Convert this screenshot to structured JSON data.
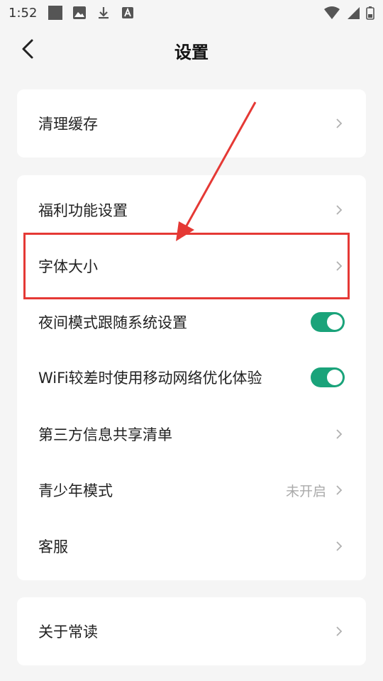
{
  "status_bar": {
    "time": "1:52",
    "left_icons": [
      "notification-square-icon",
      "image-icon",
      "download-icon",
      "font-badge-icon"
    ],
    "right_icons": [
      "wifi-icon",
      "signal-icon",
      "battery-icon"
    ]
  },
  "header": {
    "title": "设置",
    "back_icon": "chevron-left-icon"
  },
  "cards": [
    {
      "rows": [
        {
          "label": "清理缓存",
          "control": "chevron"
        }
      ]
    },
    {
      "rows": [
        {
          "label": "福利功能设置",
          "control": "chevron"
        },
        {
          "label": "字体大小",
          "control": "chevron"
        },
        {
          "label": "夜间模式跟随系统设置",
          "control": "toggle",
          "on": true
        },
        {
          "label": "WiFi较差时使用移动网络优化体验",
          "control": "toggle",
          "on": true
        },
        {
          "label": "第三方信息共享清单",
          "control": "chevron"
        },
        {
          "label": "青少年模式",
          "control": "chevron",
          "value": "未开启"
        },
        {
          "label": "客服",
          "control": "chevron"
        }
      ]
    },
    {
      "rows": [
        {
          "label": "关于常读",
          "control": "chevron"
        }
      ]
    }
  ],
  "colors": {
    "accent_toggle": "#1aa37a",
    "annotation_red": "#e53935",
    "background": "#f5f5f5"
  }
}
